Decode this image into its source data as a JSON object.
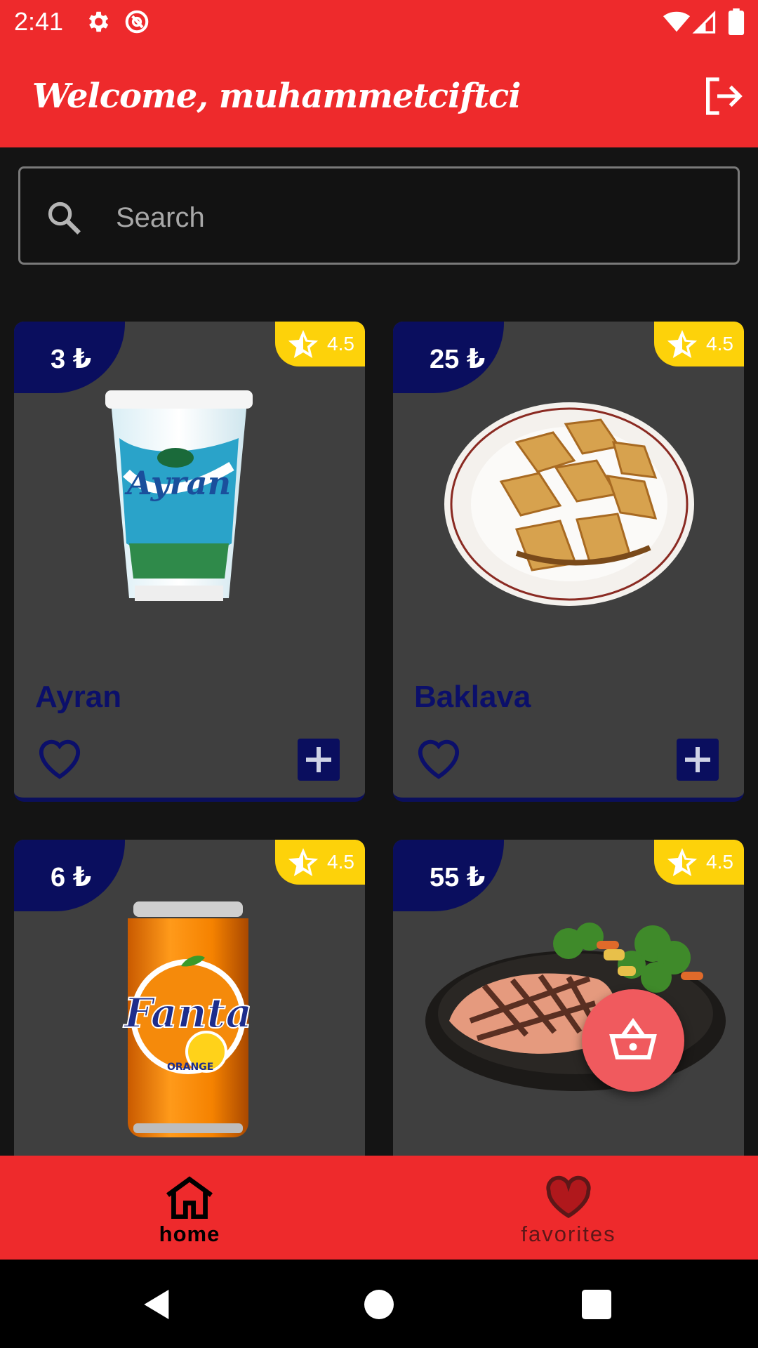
{
  "status_bar": {
    "time": "2:41",
    "icons": [
      "settings-icon",
      "do-not-disturb-icon",
      "wifi-icon",
      "signal-icon",
      "battery-icon"
    ]
  },
  "app_bar": {
    "title": "Welcome, muhammetciftci",
    "logout_icon": "logout-icon",
    "color": "#ee2a2c"
  },
  "search": {
    "placeholder": "Search",
    "value": ""
  },
  "products": [
    {
      "name": "Ayran",
      "price": "3 ₺",
      "rating": "4.5",
      "image": "ayran-cup"
    },
    {
      "name": "Baklava",
      "price": "25 ₺",
      "rating": "4.5",
      "image": "baklava-plate"
    },
    {
      "name": "",
      "price": "6 ₺",
      "rating": "4.5",
      "image": "fanta-can"
    },
    {
      "name": "",
      "price": "55 ₺",
      "rating": "4.5",
      "image": "salmon-plate"
    }
  ],
  "fab": {
    "icon": "basket-icon"
  },
  "bottom_nav": {
    "items": [
      {
        "label": "home",
        "icon": "home-icon",
        "selected": true
      },
      {
        "label": "favorites",
        "icon": "heart-icon",
        "selected": false
      }
    ]
  },
  "colors": {
    "accent": "#ee2a2c",
    "navy": "#0a0e5e",
    "rating": "#fdd20a",
    "card": "#3f3f3f",
    "background": "#141414",
    "fab": "#f05a5e"
  }
}
